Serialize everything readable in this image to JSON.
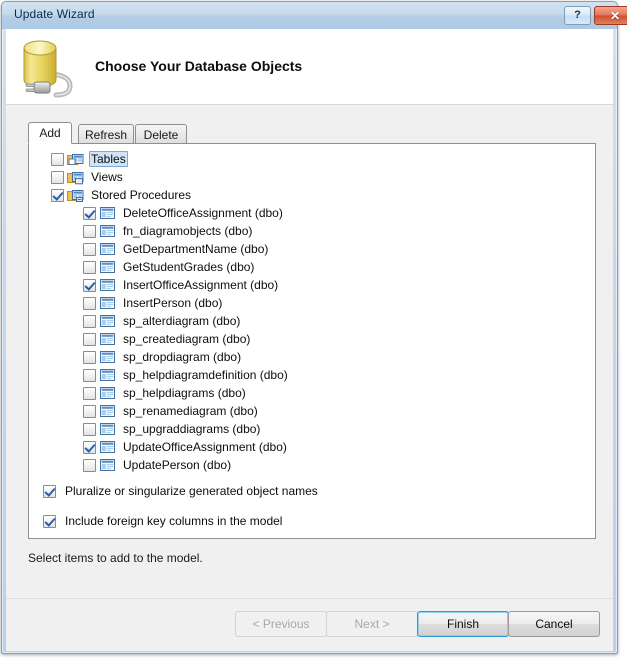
{
  "window": {
    "title": "Update Wizard",
    "help_button": "?",
    "close_button": "✕"
  },
  "header": {
    "title": "Choose Your Database Objects",
    "icon": "database-connection-icon"
  },
  "tabs": [
    {
      "label": "Add",
      "active": true
    },
    {
      "label": "Refresh",
      "active": false
    },
    {
      "label": "Delete",
      "active": false
    }
  ],
  "tree": {
    "nodes": [
      {
        "label": "Tables",
        "level": 0,
        "checked": false,
        "expander": "collapsed",
        "icon": "tables-folder-icon",
        "selected": true
      },
      {
        "label": "Views",
        "level": 0,
        "checked": false,
        "expander": "none",
        "icon": "views-folder-icon",
        "selected": false
      },
      {
        "label": "Stored Procedures",
        "level": 0,
        "checked": true,
        "expander": "expanded",
        "icon": "stored-procedures-folder-icon",
        "selected": false
      },
      {
        "label": "DeleteOfficeAssignment (dbo)",
        "level": 1,
        "checked": true,
        "expander": "none",
        "icon": "stored-procedure-icon",
        "selected": false
      },
      {
        "label": "fn_diagramobjects (dbo)",
        "level": 1,
        "checked": false,
        "expander": "none",
        "icon": "stored-procedure-icon",
        "selected": false
      },
      {
        "label": "GetDepartmentName (dbo)",
        "level": 1,
        "checked": false,
        "expander": "none",
        "icon": "stored-procedure-icon",
        "selected": false
      },
      {
        "label": "GetStudentGrades (dbo)",
        "level": 1,
        "checked": false,
        "expander": "none",
        "icon": "stored-procedure-icon",
        "selected": false
      },
      {
        "label": "InsertOfficeAssignment (dbo)",
        "level": 1,
        "checked": true,
        "expander": "none",
        "icon": "stored-procedure-icon",
        "selected": false
      },
      {
        "label": "InsertPerson (dbo)",
        "level": 1,
        "checked": false,
        "expander": "none",
        "icon": "stored-procedure-icon",
        "selected": false
      },
      {
        "label": "sp_alterdiagram (dbo)",
        "level": 1,
        "checked": false,
        "expander": "none",
        "icon": "stored-procedure-icon",
        "selected": false
      },
      {
        "label": "sp_creatediagram (dbo)",
        "level": 1,
        "checked": false,
        "expander": "none",
        "icon": "stored-procedure-icon",
        "selected": false
      },
      {
        "label": "sp_dropdiagram (dbo)",
        "level": 1,
        "checked": false,
        "expander": "none",
        "icon": "stored-procedure-icon",
        "selected": false
      },
      {
        "label": "sp_helpdiagramdefinition (dbo)",
        "level": 1,
        "checked": false,
        "expander": "none",
        "icon": "stored-procedure-icon",
        "selected": false
      },
      {
        "label": "sp_helpdiagrams (dbo)",
        "level": 1,
        "checked": false,
        "expander": "none",
        "icon": "stored-procedure-icon",
        "selected": false
      },
      {
        "label": "sp_renamediagram (dbo)",
        "level": 1,
        "checked": false,
        "expander": "none",
        "icon": "stored-procedure-icon",
        "selected": false
      },
      {
        "label": "sp_upgraddiagrams (dbo)",
        "level": 1,
        "checked": false,
        "expander": "none",
        "icon": "stored-procedure-icon",
        "selected": false
      },
      {
        "label": "UpdateOfficeAssignment (dbo)",
        "level": 1,
        "checked": true,
        "expander": "none",
        "icon": "stored-procedure-icon",
        "selected": false
      },
      {
        "label": "UpdatePerson (dbo)",
        "level": 1,
        "checked": false,
        "expander": "none",
        "icon": "stored-procedure-icon",
        "selected": false
      }
    ]
  },
  "options": [
    {
      "label": "Pluralize or singularize generated object names",
      "checked": true,
      "name": "pluralize-option"
    },
    {
      "label": "Include foreign key columns in the model",
      "checked": true,
      "name": "foreign-key-option"
    }
  ],
  "status": {
    "text": "Select items to add to the model."
  },
  "footer": {
    "buttons": [
      {
        "label": "< Previous",
        "state": "disabled",
        "name": "previous-button"
      },
      {
        "label": "Next >",
        "state": "disabled",
        "name": "next-button"
      },
      {
        "label": "Finish",
        "state": "focused",
        "name": "finish-button"
      },
      {
        "label": "Cancel",
        "state": "normal",
        "name": "cancel-button"
      }
    ]
  },
  "colors": {
    "title_bar": "#c6d9ec",
    "body": "#f0f0f0",
    "panel": "#ffffff",
    "selection": "#cfe4f7",
    "focus_accent": "#2e9bd6",
    "close_button": "#cf4e2e",
    "checkmark": "#2c5fa8"
  }
}
